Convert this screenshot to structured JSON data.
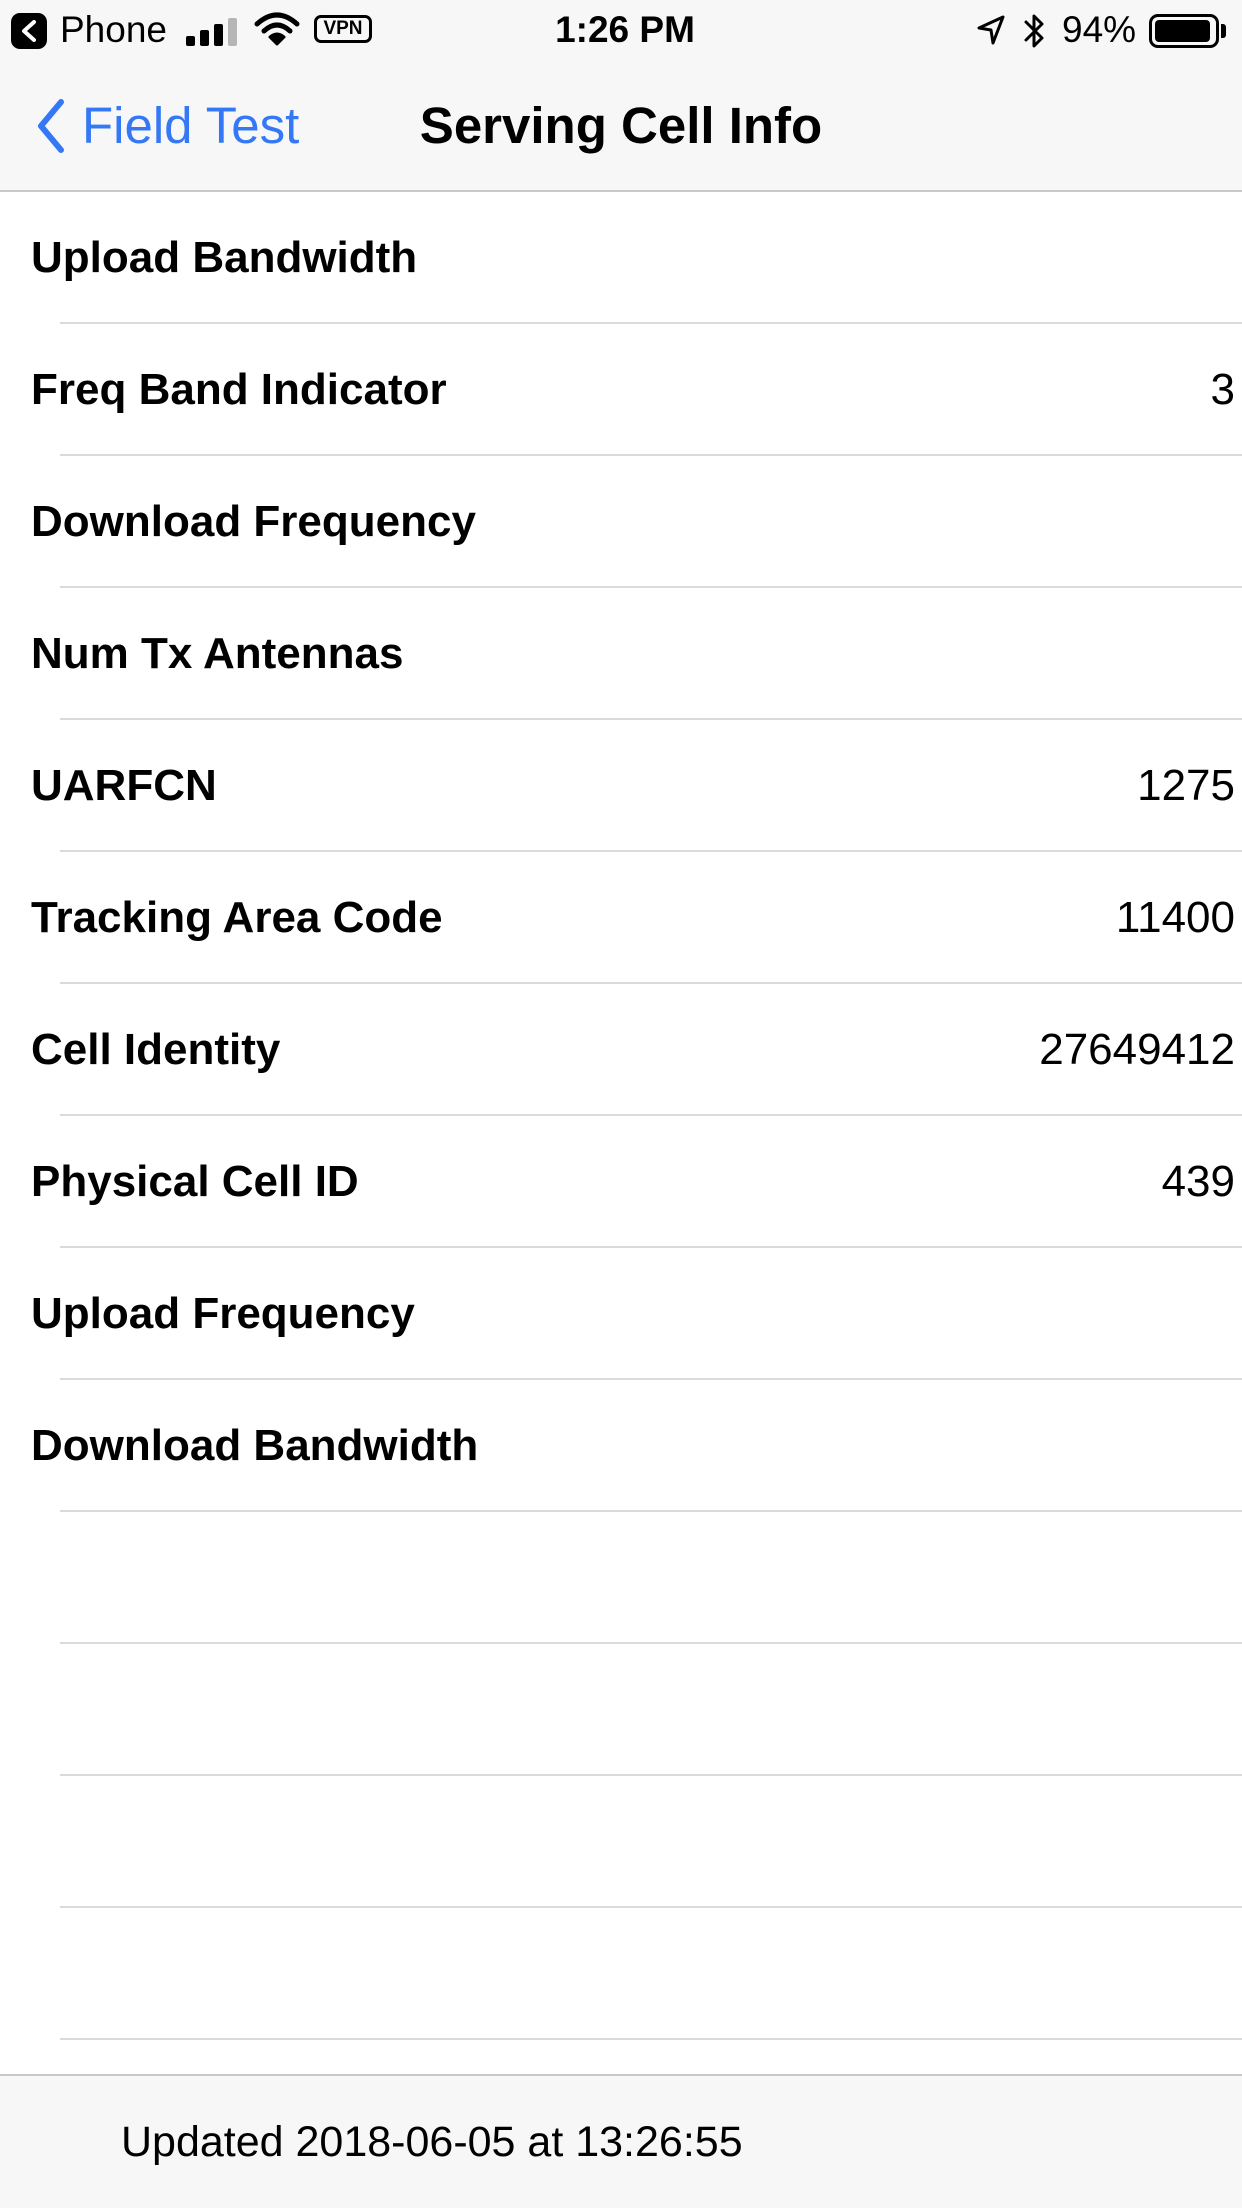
{
  "status_bar": {
    "back_app": "Phone",
    "time": "1:26 PM",
    "vpn_label": "VPN",
    "battery_percent_text": "94%",
    "battery_level": 0.94,
    "signal_bars_filled": 3,
    "signal_bars_total": 4,
    "icons": [
      "back-app-icon",
      "signal-icon",
      "wifi-icon",
      "vpn-icon",
      "location-icon",
      "bluetooth-icon",
      "battery-icon"
    ]
  },
  "nav": {
    "back_label": "Field Test",
    "title": "Serving Cell Info"
  },
  "rows": [
    {
      "label": "Upload Bandwidth",
      "value": ""
    },
    {
      "label": "Freq Band Indicator",
      "value": "3"
    },
    {
      "label": "Download Frequency",
      "value": ""
    },
    {
      "label": "Num Tx Antennas",
      "value": ""
    },
    {
      "label": "UARFCN",
      "value": "1275"
    },
    {
      "label": "Tracking Area Code",
      "value": "11400"
    },
    {
      "label": "Cell Identity",
      "value": "27649412"
    },
    {
      "label": "Physical Cell ID",
      "value": "439"
    },
    {
      "label": "Upload Frequency",
      "value": ""
    },
    {
      "label": "Download Bandwidth",
      "value": ""
    },
    {
      "label": "",
      "value": ""
    },
    {
      "label": "",
      "value": ""
    },
    {
      "label": "",
      "value": ""
    },
    {
      "label": "",
      "value": ""
    }
  ],
  "toolbar": {
    "updated_text": "Updated 2018-06-05 at 13:26:55"
  },
  "colors": {
    "accent": "#3478f6",
    "bar_background": "#f7f7f7",
    "separator": "#d9d9de"
  }
}
